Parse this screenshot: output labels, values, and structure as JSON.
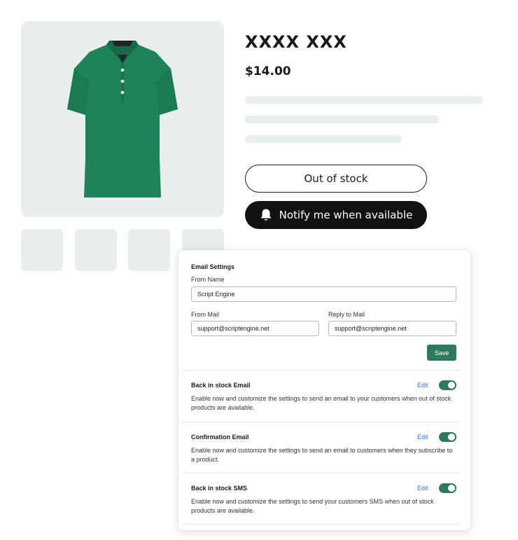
{
  "product": {
    "title": "XXXX XXX",
    "price": "$14.00",
    "image_icon": "polo-shirt-image",
    "shirt_color": "#1f8358",
    "out_of_stock_label": "Out of stock",
    "notify_label": "Notify me when available",
    "notify_icon": "bell-icon"
  },
  "email_settings": {
    "title": "Email Settings",
    "from_name_label": "From Name",
    "from_name_value": "Script Engine",
    "from_mail_label": "From Mail",
    "from_mail_value": "support@scriptengine.net",
    "reply_to_label": "Reply to Mail",
    "reply_to_value": "support@scriptengine.net",
    "save_label": "Save"
  },
  "sections": [
    {
      "title": "Back in stock Email",
      "edit_label": "Edit",
      "enabled": true,
      "description": "Enable now and customize the settings to send an email to your customers when out of stock products are available."
    },
    {
      "title": "Confirmation Email",
      "edit_label": "Edit",
      "enabled": true,
      "description": "Enable now and customize the settings to send an email to customers when they subscribe to a product."
    },
    {
      "title": "Back in stock SMS",
      "edit_label": "Edit",
      "enabled": true,
      "description": "Enable now and customize the settings to send your customers SMS when out of stock products are available."
    }
  ],
  "colors": {
    "accent_green": "#2f7a5c",
    "link_blue": "#2f6fd0",
    "image_bg": "#e8efec"
  }
}
